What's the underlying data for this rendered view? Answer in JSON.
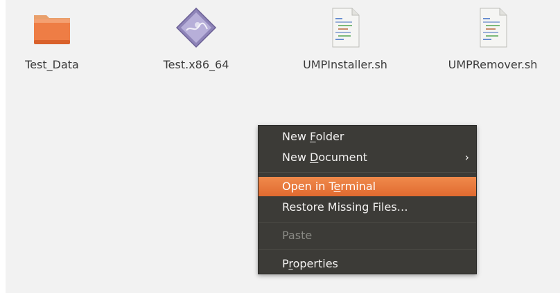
{
  "files": [
    {
      "name": "Test_Data",
      "icon": "folder-icon"
    },
    {
      "name": "Test.x86_64",
      "icon": "executable-icon"
    },
    {
      "name": "UMPInstaller.sh",
      "icon": "script-file-icon"
    },
    {
      "name": "UMPRemover.sh",
      "icon": "script-file-icon"
    }
  ],
  "context_menu": {
    "new_folder": {
      "before": "New ",
      "mnemonic": "F",
      "after": "older"
    },
    "new_document": {
      "before": "New ",
      "mnemonic": "D",
      "after": "ocument",
      "arrow": "›"
    },
    "open_terminal": {
      "before": "Open in T",
      "mnemonic": "e",
      "after": "rminal"
    },
    "restore_missing": {
      "label": "Restore Missing Files…"
    },
    "paste": {
      "label": "Paste"
    },
    "properties": {
      "before": "P",
      "mnemonic": "r",
      "after": "operties"
    }
  },
  "colors": {
    "menu_background": "#3c3b37",
    "highlight": "#e9733b",
    "desktop_background": "#f2f2f2"
  }
}
